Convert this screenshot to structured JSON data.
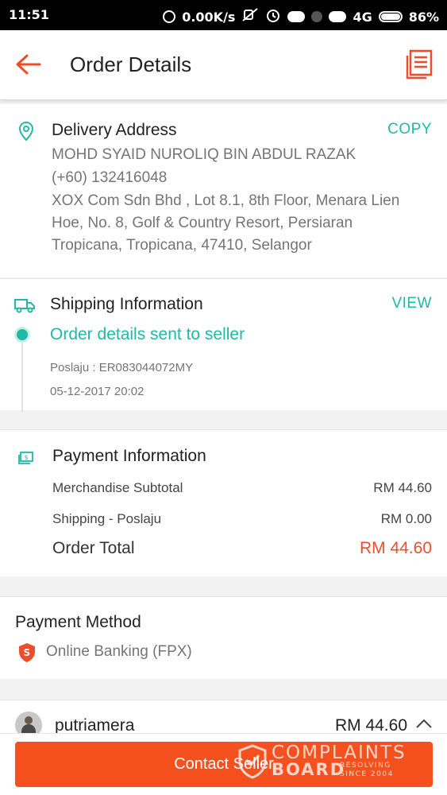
{
  "status_bar": {
    "time": "11:51",
    "speed": "0.00K/s",
    "network": "4G",
    "battery": "86%"
  },
  "header": {
    "title": "Order Details"
  },
  "delivery": {
    "title": "Delivery Address",
    "copy_label": "COPY",
    "name": "MOHD SYAID NUROLIQ BIN ABDUL RAZAK",
    "phone": "(+60) 132416048",
    "address_lines": [
      "XOX Com Sdn Bhd , Lot 8.1, 8th Floor, Menara Lien",
      "Hoe, No. 8, Golf & Country Resort, Persiaran",
      "Tropicana, Tropicana, 47410, Selangor"
    ]
  },
  "shipping": {
    "title": "Shipping Information",
    "view_label": "VIEW",
    "status": "Order details sent to seller",
    "tracking": "Poslaju :  ER083044072MY",
    "timestamp": "05-12-2017 20:02"
  },
  "payment_info": {
    "title": "Payment Information",
    "rows": [
      {
        "label": "Merchandise Subtotal",
        "value": "RM 44.60"
      },
      {
        "label": "Shipping - Poslaju",
        "value": "RM 0.00"
      }
    ],
    "total_label": "Order Total",
    "total_value": "RM 44.60"
  },
  "payment_method": {
    "title": "Payment Method",
    "value": "Online Banking (FPX)"
  },
  "seller": {
    "name": "putriamera",
    "total": "RM 44.60"
  },
  "bottom": {
    "contact_label": "Contact Seller"
  },
  "watermark": {
    "line1": "COMPLAINTS",
    "line2": "BOARD",
    "line3": "RESOLVING",
    "line4": "SINCE 2004"
  },
  "colors": {
    "accent_orange": "#ee4d2d",
    "button_orange": "#f4511e",
    "teal": "#1fb9a5"
  },
  "icons": {
    "back": "arrow-left-icon",
    "orders": "document-list-icon",
    "pin": "map-pin-icon",
    "truck": "truck-icon",
    "cash": "cash-icon",
    "shield": "shield-icon",
    "chevron": "chevron-up-icon"
  }
}
